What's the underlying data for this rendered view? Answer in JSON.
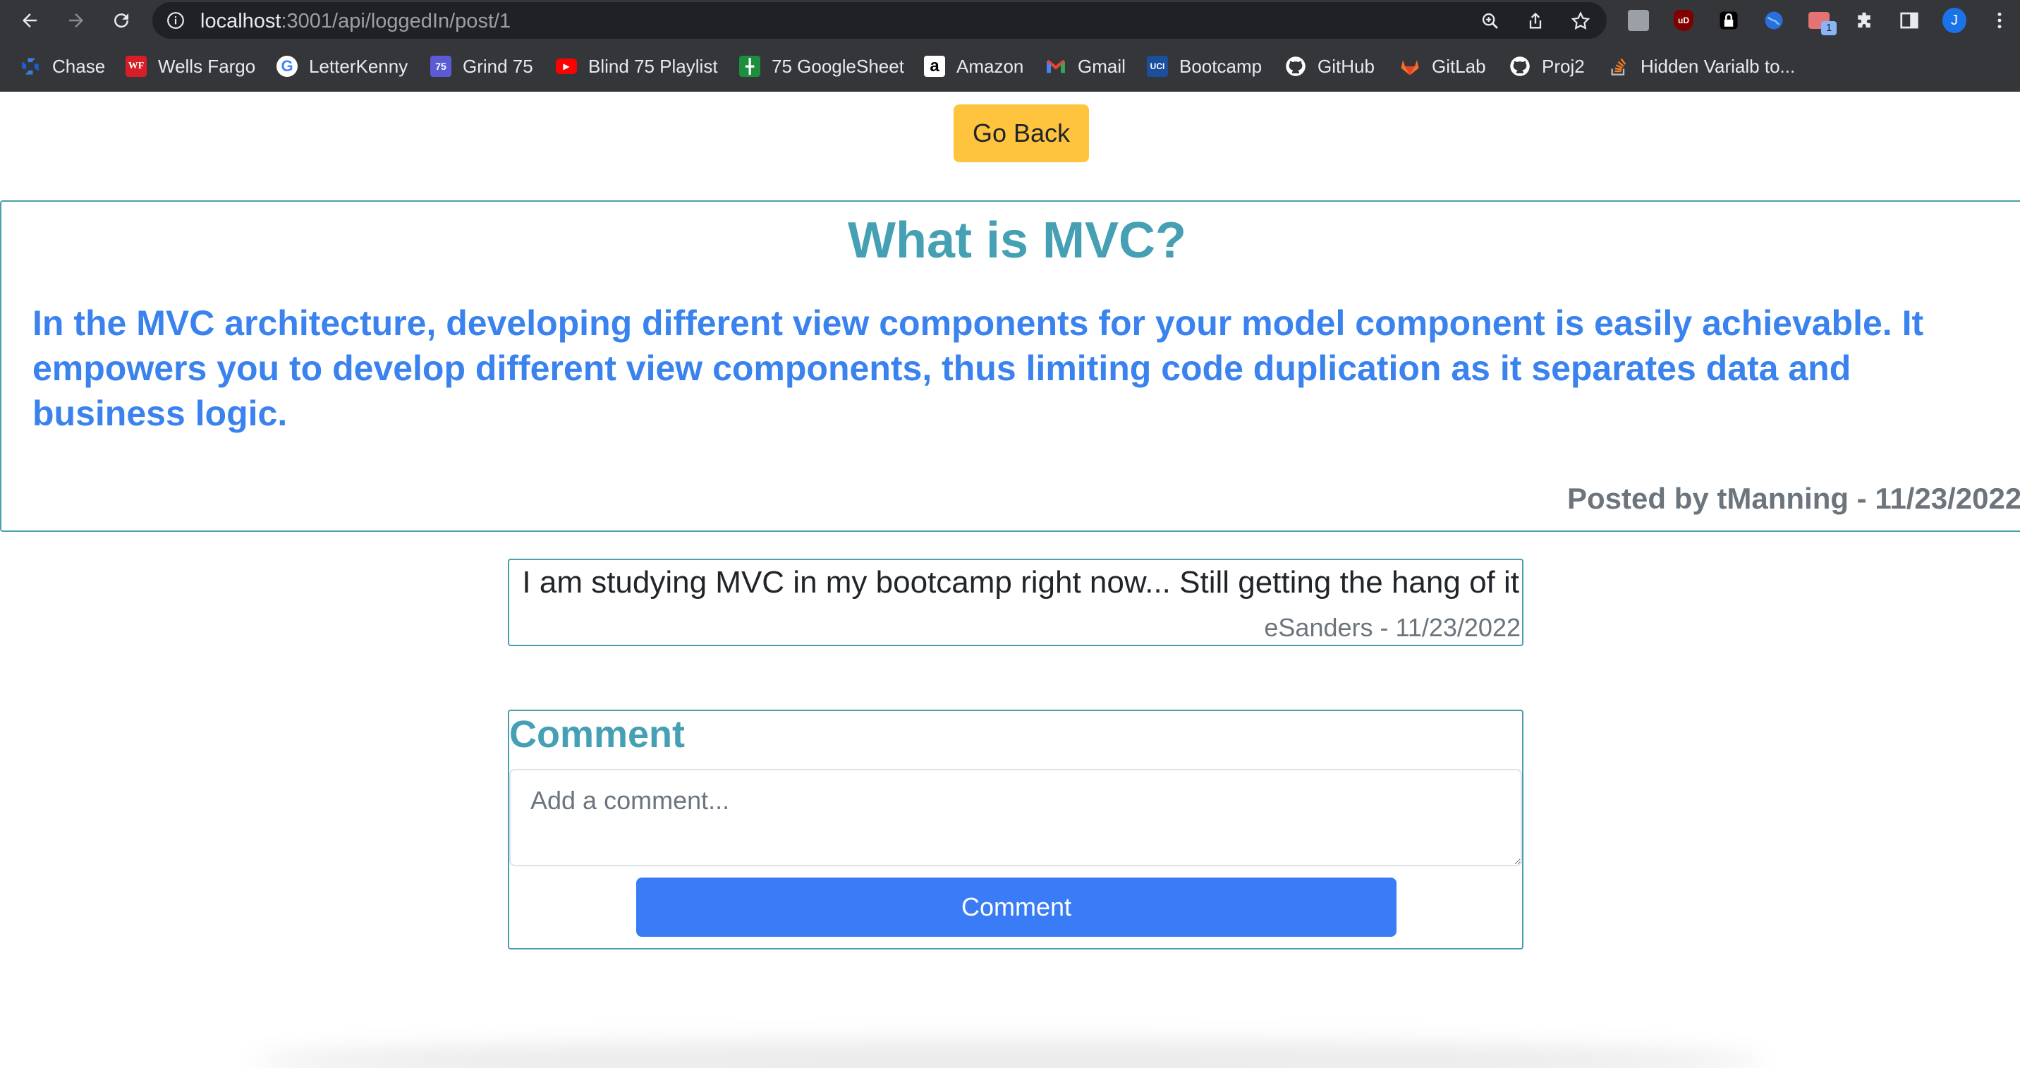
{
  "browser": {
    "url_host": "localhost",
    "url_path": ":3001/api/loggedIn/post/1",
    "extension_badge": "1",
    "profile_initial": "J"
  },
  "bookmarks": [
    {
      "label": "Chase",
      "icon": "chase-icon",
      "glyph": "",
      "color": "#1a5fd6"
    },
    {
      "label": "Wells Fargo",
      "icon": "wells-fargo-icon",
      "glyph": "WF",
      "color": "#d71e28"
    },
    {
      "label": "LetterKenny",
      "icon": "google-icon",
      "glyph": "G",
      "color": "#ffffff"
    },
    {
      "label": "Grind 75",
      "icon": "grind75-icon",
      "glyph": "75",
      "color": "#5b5bd6"
    },
    {
      "label": "Blind 75 Playlist",
      "icon": "youtube-icon",
      "glyph": "▶",
      "color": "#ff0000"
    },
    {
      "label": "75 GoogleSheet",
      "icon": "sheets-icon",
      "glyph": "╋",
      "color": "#1e8e3e"
    },
    {
      "label": "Amazon",
      "icon": "amazon-icon",
      "glyph": "a",
      "color": "#ffffff"
    },
    {
      "label": "Gmail",
      "icon": "gmail-icon",
      "glyph": "M",
      "color": "#35363a"
    },
    {
      "label": "Bootcamp",
      "icon": "uci-icon",
      "glyph": "UCI",
      "color": "#1b4f9c"
    },
    {
      "label": "GitHub",
      "icon": "github-icon",
      "glyph": "●",
      "color": "#35363a"
    },
    {
      "label": "GitLab",
      "icon": "gitlab-icon",
      "glyph": "▼",
      "color": "#35363a"
    },
    {
      "label": "Proj2",
      "icon": "github-icon",
      "glyph": "●",
      "color": "#35363a"
    },
    {
      "label": "Hidden Varialb to...",
      "icon": "stackoverflow-icon",
      "glyph": "≡",
      "color": "#35363a"
    }
  ],
  "page": {
    "go_back_label": "Go Back",
    "post": {
      "title": "What is MVC?",
      "body": "In the MVC architecture, developing different view components for your model component is easily achievable. It empowers you to develop different view components, thus limiting code duplication as it separates data and business logic.",
      "meta": "Posted by tManning - 11/23/2022"
    },
    "comments": [
      {
        "text": "I am studying MVC in my bootcamp right now... Still getting the hang of it",
        "meta": "eSanders - 11/23/2022"
      }
    ],
    "comment_form": {
      "heading": "Comment",
      "placeholder": "Add a comment...",
      "submit_label": "Comment"
    }
  },
  "colors": {
    "chrome_bg": "#35363a",
    "omnibox_bg": "#202124",
    "warning": "#ffc43d",
    "primary": "#3a7cf5",
    "teal": "#45a0b3",
    "muted": "#6c757d"
  }
}
